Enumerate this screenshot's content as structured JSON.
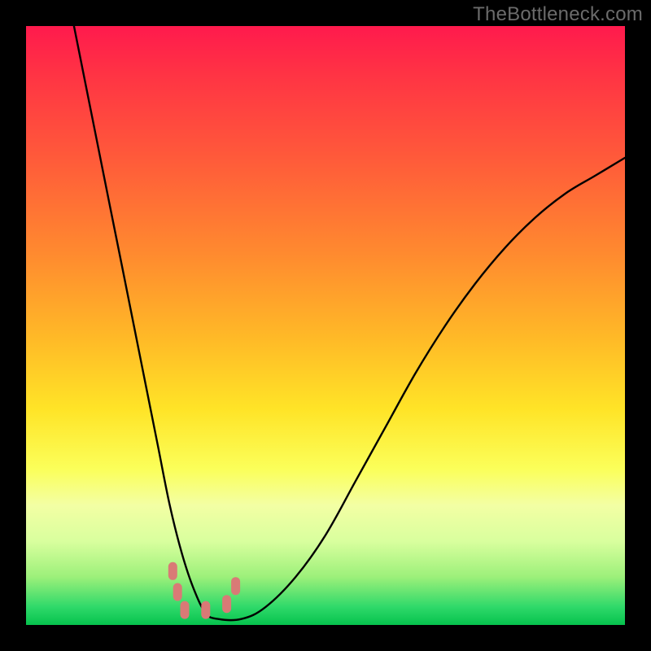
{
  "watermark": "TheBottleneck.com",
  "chart_data": {
    "type": "line",
    "title": "",
    "xlabel": "",
    "ylabel": "",
    "xlim": [
      0,
      100
    ],
    "ylim": [
      0,
      100
    ],
    "series": [
      {
        "name": "bottleneck-curve",
        "x": [
          8,
          10,
          12,
          14,
          16,
          18,
          20,
          22,
          24,
          26,
          28,
          30,
          32,
          36,
          40,
          45,
          50,
          55,
          60,
          65,
          70,
          75,
          80,
          85,
          90,
          95,
          100
        ],
        "values": [
          100,
          90,
          80,
          70,
          60,
          50,
          40,
          30,
          20,
          12,
          6,
          2,
          1,
          1,
          3,
          8,
          15,
          24,
          33,
          42,
          50,
          57,
          63,
          68,
          72,
          75,
          78
        ]
      }
    ],
    "markers": [
      {
        "x": 24.5,
        "y": 9.0,
        "color": "#d97a76"
      },
      {
        "x": 25.3,
        "y": 5.5,
        "color": "#d97a76"
      },
      {
        "x": 26.5,
        "y": 2.5,
        "color": "#d97a76"
      },
      {
        "x": 30.0,
        "y": 2.5,
        "color": "#d97a76"
      },
      {
        "x": 33.5,
        "y": 3.5,
        "color": "#d97a76"
      },
      {
        "x": 35.0,
        "y": 6.5,
        "color": "#d97a76"
      }
    ],
    "gradient_stops": [
      {
        "pos": 0.0,
        "color": "#ff1a4d"
      },
      {
        "pos": 0.25,
        "color": "#ff7a30"
      },
      {
        "pos": 0.55,
        "color": "#ffd827"
      },
      {
        "pos": 0.8,
        "color": "#f0ff90"
      },
      {
        "pos": 1.0,
        "color": "#06c24d"
      }
    ]
  }
}
